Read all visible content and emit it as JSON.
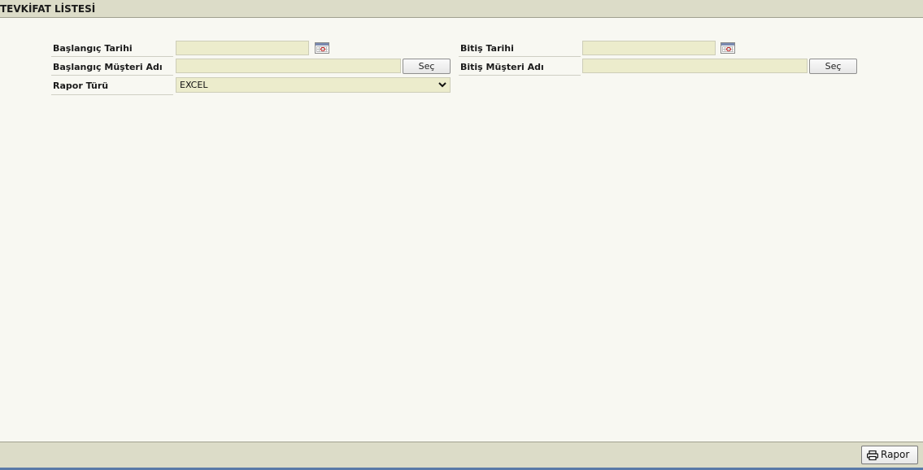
{
  "header": {
    "title": "TEVKİFAT LİSTESİ"
  },
  "form": {
    "start_date_label": "Başlangıç Tarihi",
    "start_date_value": "",
    "end_date_label": "Bitiş Tarihi",
    "end_date_value": "",
    "start_customer_label": "Başlangıç Müşteri Adı",
    "start_customer_value": "",
    "start_customer_select_label": "Seç",
    "end_customer_label": "Bitiş Müşteri Adı",
    "end_customer_value": "",
    "end_customer_select_label": "Seç",
    "report_type_label": "Rapor Türü",
    "report_type_value": "EXCEL"
  },
  "footer": {
    "report_button_label": "Rapor"
  },
  "icons": {
    "calendar": "calendar-icon",
    "printer": "printer-icon",
    "dropdown": "chevron-down-icon"
  }
}
